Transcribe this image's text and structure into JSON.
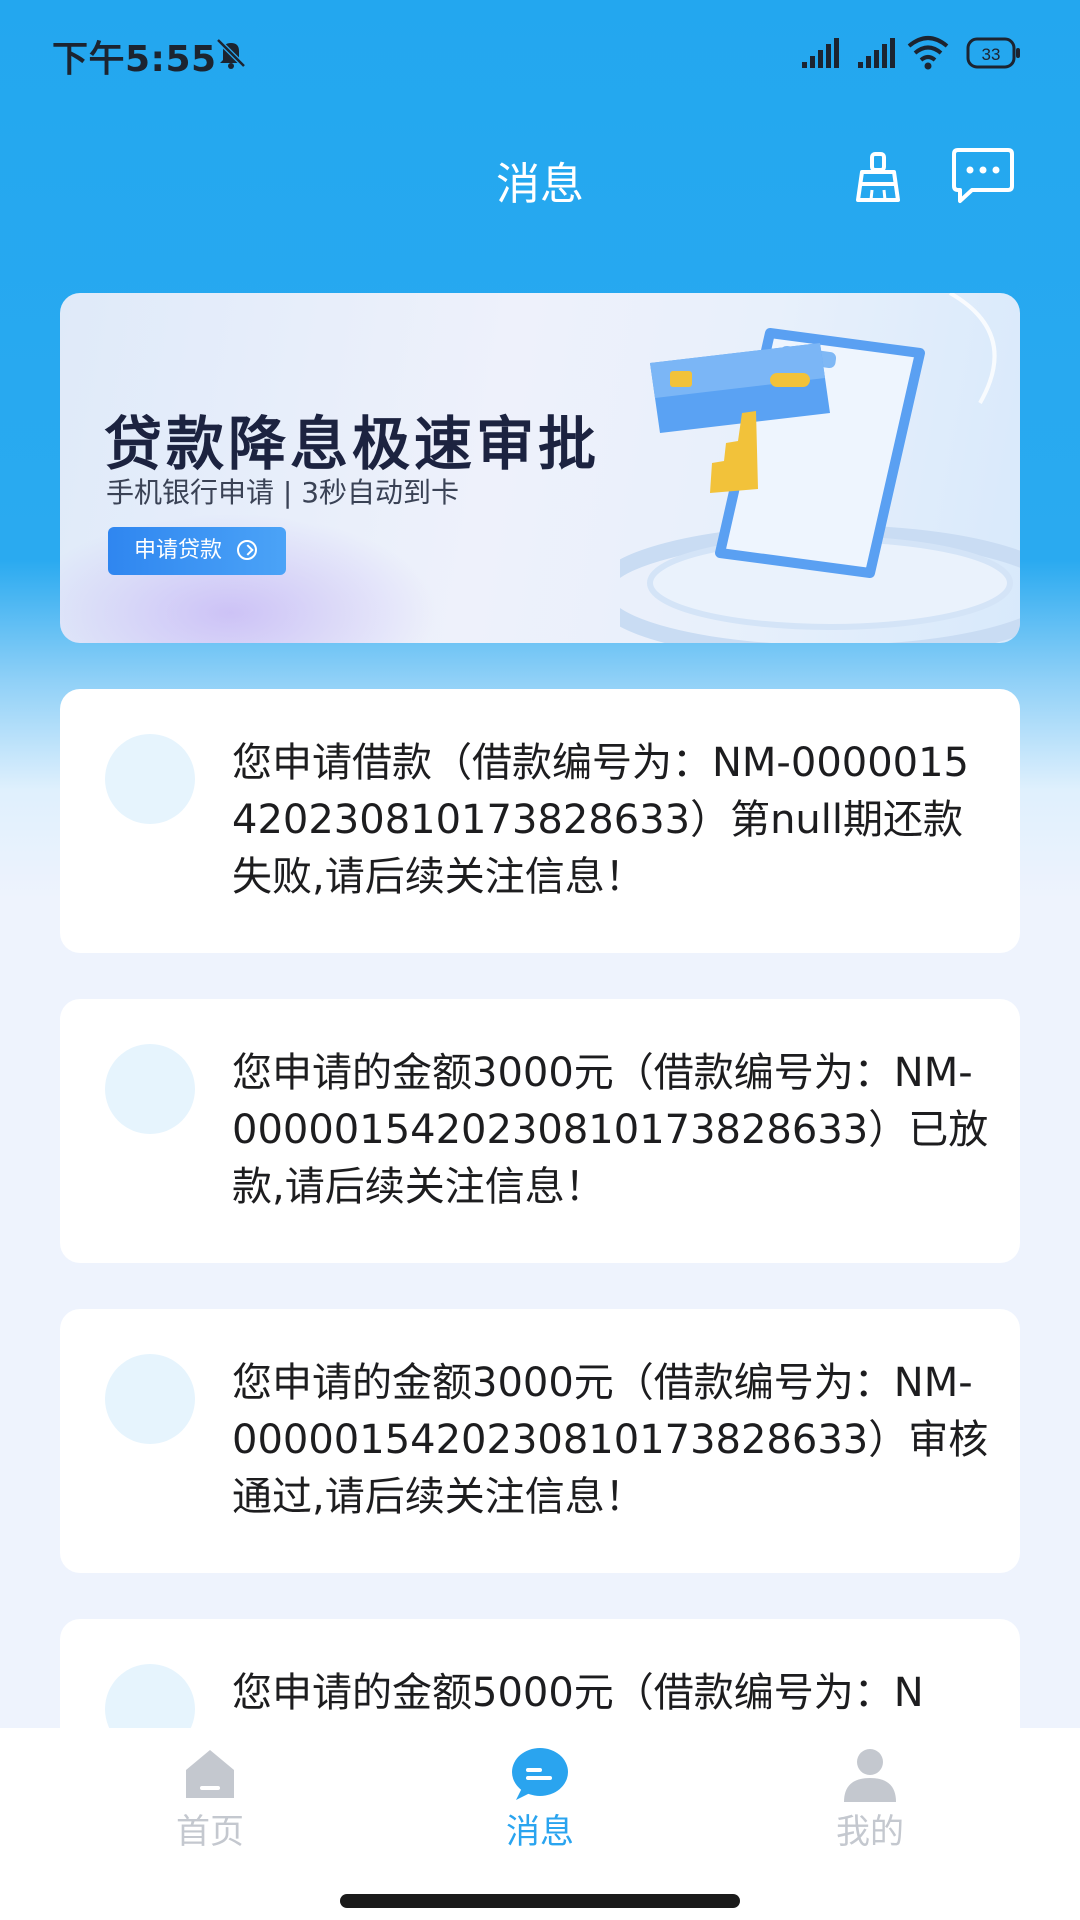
{
  "status_bar": {
    "time": "下午5:55",
    "battery": "33"
  },
  "header": {
    "title": "消息"
  },
  "banner": {
    "title": "贷款降息极速审批",
    "subtitle": "手机银行申请 | 3秒自动到卡",
    "button_label": "申请贷款"
  },
  "messages": [
    {
      "text": "您申请借款（借款编号为：NM-0000015420230810173828633）第null期还款失败,请后续关注信息！"
    },
    {
      "text": "您申请的金额3000元（借款编号为：NM-0000015420230810173828633）已放款,请后续关注信息！"
    },
    {
      "text": "您申请的金额3000元（借款编号为：NM-0000015420230810173828633）审核通过,请后续关注信息！"
    },
    {
      "text": "您申请的金额5000元（借款编号为：N"
    }
  ],
  "tabbar": {
    "tabs": [
      {
        "label": "首页",
        "icon": "home-icon",
        "active": false
      },
      {
        "label": "消息",
        "icon": "message-icon",
        "active": true
      },
      {
        "label": "我的",
        "icon": "profile-icon",
        "active": false
      }
    ]
  },
  "colors": {
    "primary": "#23a7ef",
    "active_tab": "#2aa4ef",
    "inactive_tab": "#c4c8cf"
  }
}
